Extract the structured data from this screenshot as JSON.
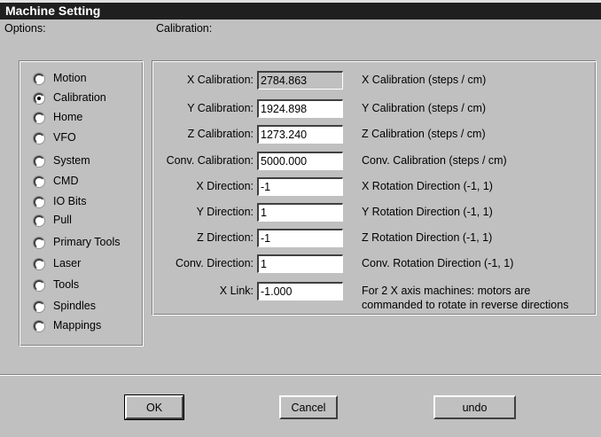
{
  "window": {
    "title": "Machine Setting"
  },
  "options": {
    "label": "Options:",
    "items": [
      {
        "label": "Motion",
        "checked": false
      },
      {
        "label": "Calibration",
        "checked": true
      },
      {
        "label": "Home",
        "checked": false
      },
      {
        "label": "VFO",
        "checked": false
      },
      {
        "label": "System",
        "checked": false
      },
      {
        "label": "CMD",
        "checked": false
      },
      {
        "label": "IO Bits",
        "checked": false
      },
      {
        "label": "Pull",
        "checked": false
      },
      {
        "label": "Primary Tools",
        "checked": false
      },
      {
        "label": "Laser",
        "checked": false
      },
      {
        "label": "Tools",
        "checked": false
      },
      {
        "label": "Spindles",
        "checked": false
      },
      {
        "label": "Mappings",
        "checked": false
      }
    ]
  },
  "calibration": {
    "label": "Calibration:",
    "fields": [
      {
        "label": "X Calibration:",
        "value": "2784.863",
        "desc": "X Calibration (steps / cm)"
      },
      {
        "label": "Y Calibration:",
        "value": "1924.898",
        "desc": "Y Calibration (steps / cm)"
      },
      {
        "label": "Z Calibration:",
        "value": "1273.240",
        "desc": "Z Calibration (steps / cm)"
      },
      {
        "label": "Conv. Calibration:",
        "value": "5000.000",
        "desc": "Conv. Calibration (steps / cm)"
      },
      {
        "label": "X Direction:",
        "value": "-1",
        "desc": "X Rotation Direction (-1, 1)"
      },
      {
        "label": "Y Direction:",
        "value": "1",
        "desc": "Y Rotation Direction (-1, 1)"
      },
      {
        "label": "Z Direction:",
        "value": "-1",
        "desc": "Z Rotation Direction (-1, 1)"
      },
      {
        "label": "Conv. Direction:",
        "value": "1",
        "desc": "Conv. Rotation Direction (-1, 1)"
      },
      {
        "label": "X Link:",
        "value": "-1.000",
        "desc": "For 2 X axis machines: motors are",
        "desc2": "commanded to rotate in reverse directions"
      }
    ]
  },
  "buttons": {
    "ok": "OK",
    "cancel": "Cancel",
    "undo": "undo"
  }
}
